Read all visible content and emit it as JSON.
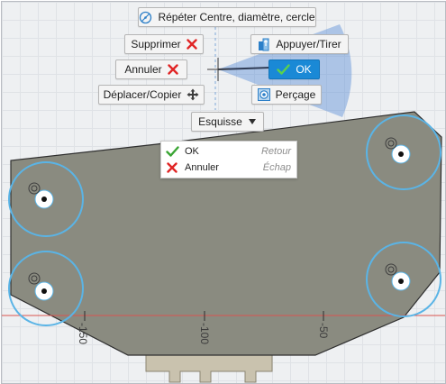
{
  "marking_menu": {
    "top_command": {
      "label": "Répéter Centre, diamètre, cercle",
      "icon": "circle-center-diameter-icon"
    },
    "delete": {
      "label": "Supprimer",
      "icon": "red-x-icon"
    },
    "undo": {
      "label": "Annuler",
      "icon": "red-x-icon"
    },
    "move_copy": {
      "label": "Déplacer/Copier",
      "icon": "move-arrows-icon"
    },
    "press_pull": {
      "label": "Appuyer/Tirer",
      "icon": "press-pull-icon"
    },
    "ok": {
      "label": "OK",
      "icon": "green-check-icon"
    },
    "hole": {
      "label": "Perçage",
      "icon": "hole-icon"
    },
    "sketch": {
      "label": "Esquisse",
      "icon": "chevron-down-icon"
    }
  },
  "sketch_dropdown": {
    "items": [
      {
        "label": "OK",
        "shortcut": "Retour",
        "icon": "green-check-icon"
      },
      {
        "label": "Annuler",
        "shortcut": "Échap",
        "icon": "red-x-icon"
      }
    ]
  },
  "ruler": {
    "labels": [
      "-150",
      "-100",
      "-50"
    ]
  },
  "colors": {
    "accent": "#1a89d6",
    "plate": "#8a8b80",
    "circle_selected": "#5ab4e6",
    "axis_red": "#d9534f",
    "delete_red": "#e02525",
    "ok_green": "#3aa534"
  }
}
